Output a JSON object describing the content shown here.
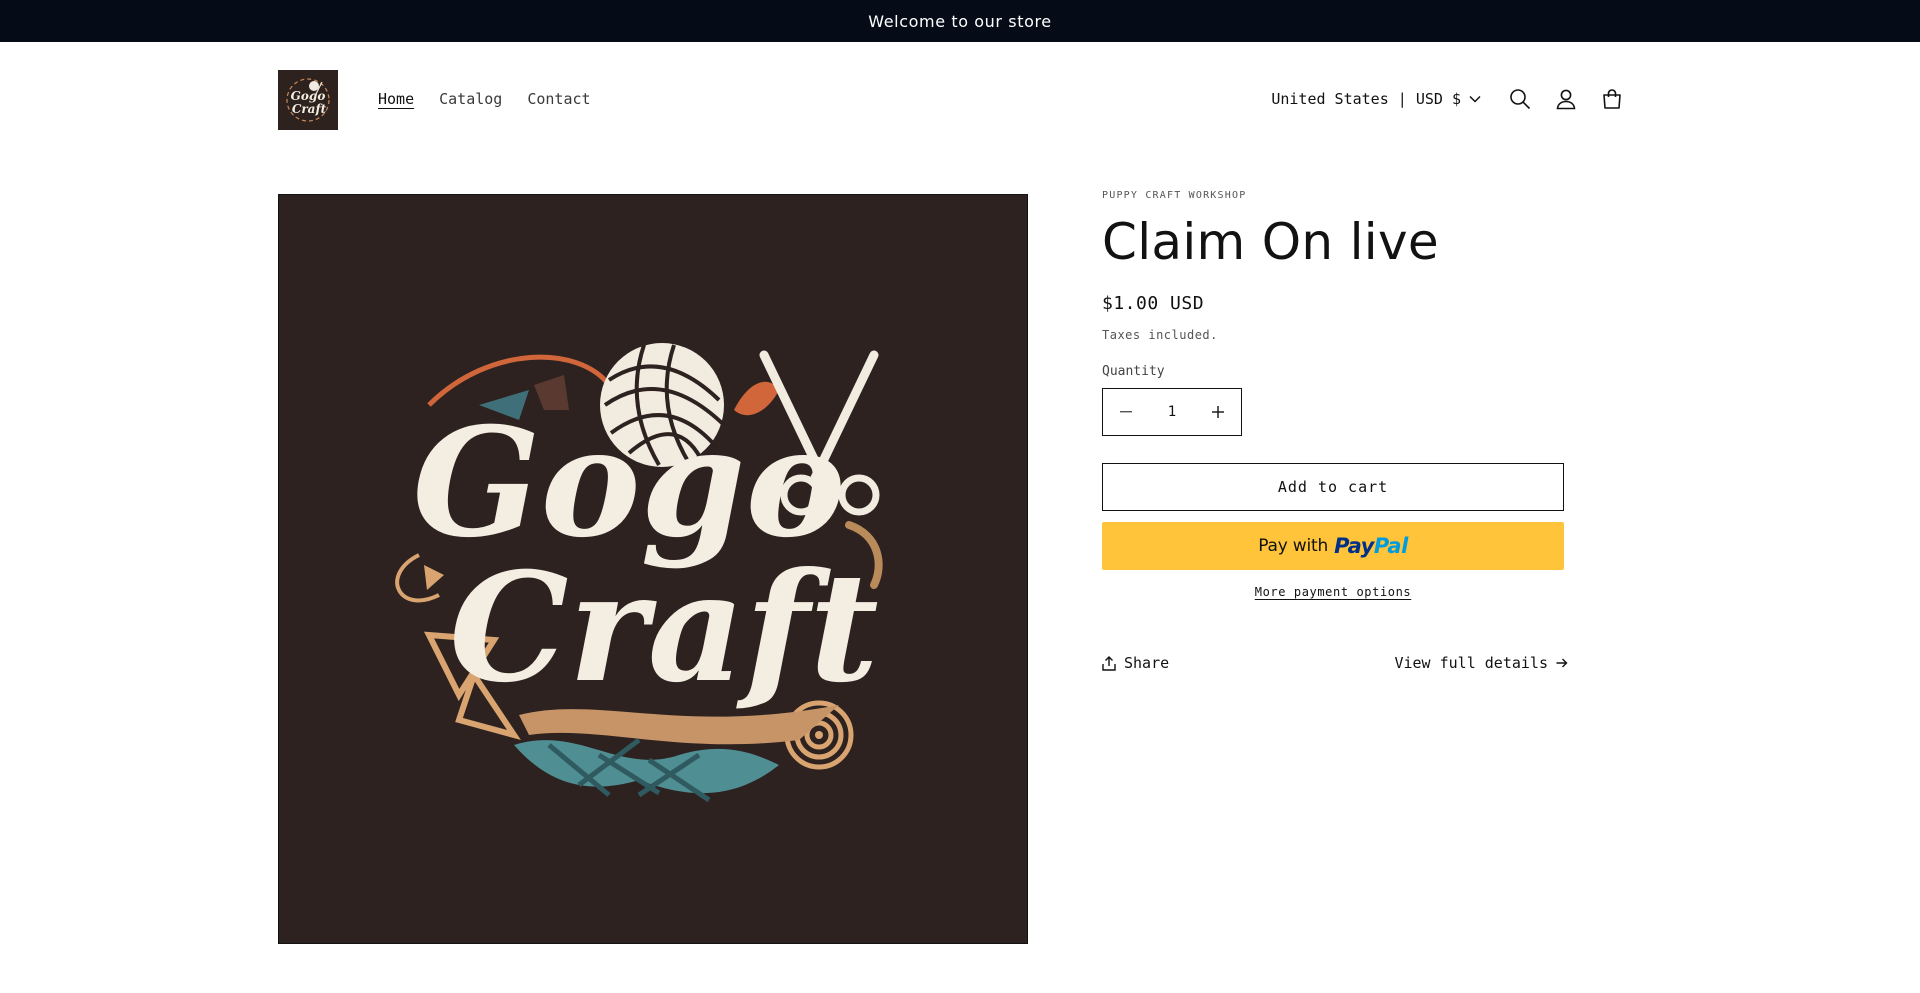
{
  "announcement": {
    "text": "Welcome to our store"
  },
  "header": {
    "logo_text_top": "Gogo",
    "logo_text_bottom": "Craft",
    "nav": [
      {
        "label": "Home",
        "active": true
      },
      {
        "label": "Catalog",
        "active": false
      },
      {
        "label": "Contact",
        "active": false
      }
    ],
    "country_selector": "United States | USD $",
    "icons": [
      "search-icon",
      "account-icon",
      "cart-icon"
    ]
  },
  "product": {
    "image_text_top": "Gogo",
    "image_text_bottom": "Craft",
    "vendor": "PUPPY CRAFT WORKSHOP",
    "title": "Claim On live",
    "price": "$1.00 USD",
    "tax_note": "Taxes included.",
    "quantity_label": "Quantity",
    "quantity_value": "1",
    "add_to_cart": "Add to cart",
    "paypal_prefix": "Pay with",
    "paypal_brand_1": "Pay",
    "paypal_brand_2": "Pal",
    "more_payment": "More payment options",
    "share": "Share",
    "view_details": "View full details"
  },
  "colors": {
    "announcement_bg": "#050c18",
    "image_bg": "#2d2220",
    "paypal_yellow": "#ffc439",
    "paypal_blue_dark": "#003087",
    "paypal_blue_light": "#009cde"
  }
}
